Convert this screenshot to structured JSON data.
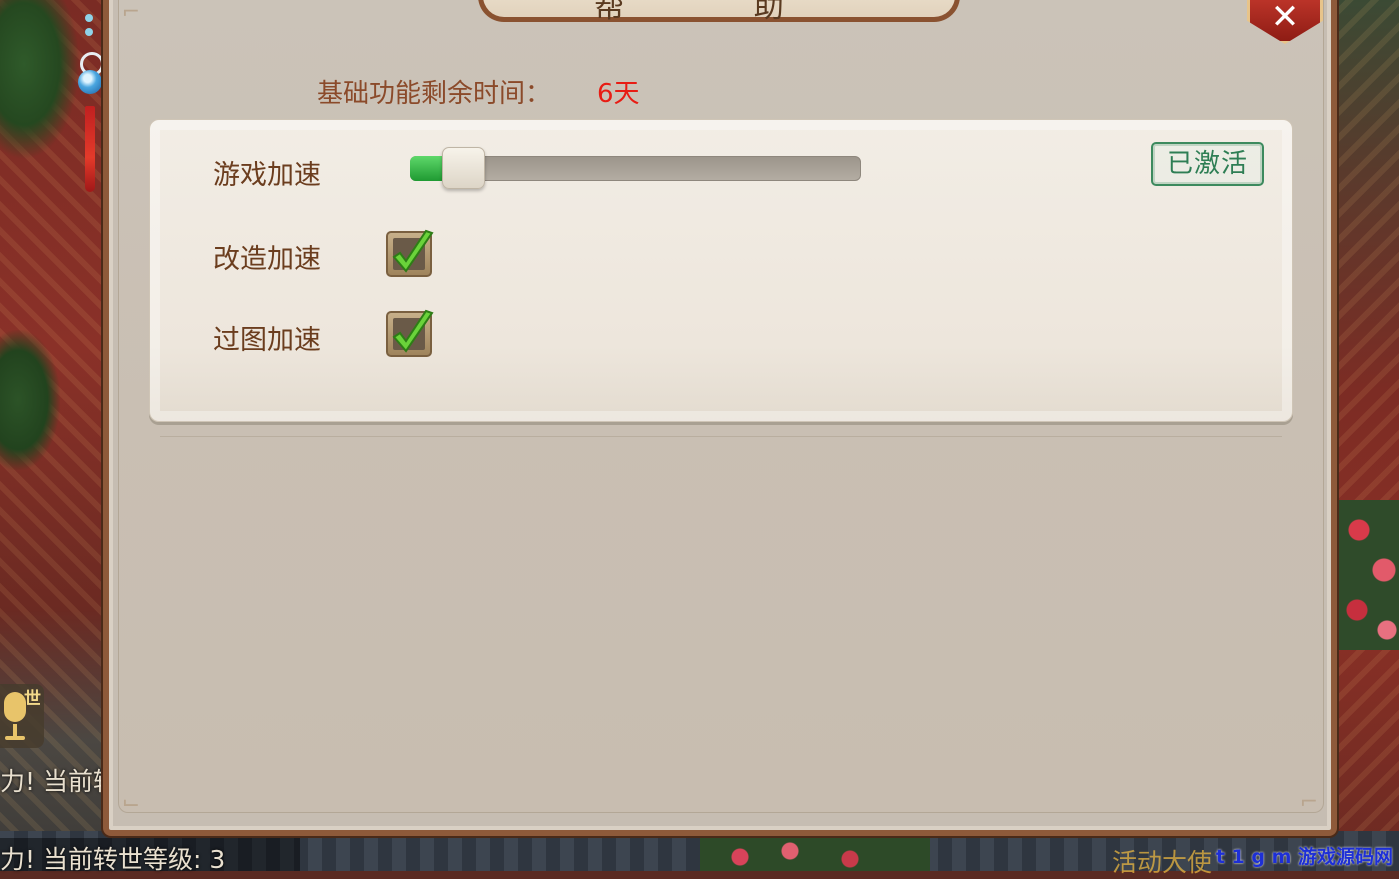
{
  "dialog": {
    "title": "帮 助",
    "close_label": "✕"
  },
  "remaining": {
    "label": "基础功能剩余时间：",
    "value": "6天"
  },
  "settings": {
    "items": [
      {
        "label": "游戏加速",
        "control": "slider",
        "level": 0.03
      },
      {
        "label": "改造加速",
        "control": "checkbox",
        "checked": true
      },
      {
        "label": "过图加速",
        "control": "checkbox",
        "checked": true
      }
    ],
    "status_label": "已激活"
  },
  "background": {
    "chat_lines": [
      "力! 当前转",
      "力! 当前转世等级: 3"
    ],
    "mic_label": "世",
    "bottom_label": "活动大使",
    "watermark": "t 1 g m 游戏源码网"
  },
  "colors": {
    "panel_bg": "#c6bdb2",
    "panel_border": "#8e5a3a",
    "label_brown": "#8b4a2a",
    "value_red": "#e81c14",
    "stamp_green": "#2e7e54",
    "slider_green": "#1f9a32"
  },
  "icons": {
    "close": "close-icon",
    "checkmark": "checkmark-icon",
    "mic": "microphone-icon"
  }
}
